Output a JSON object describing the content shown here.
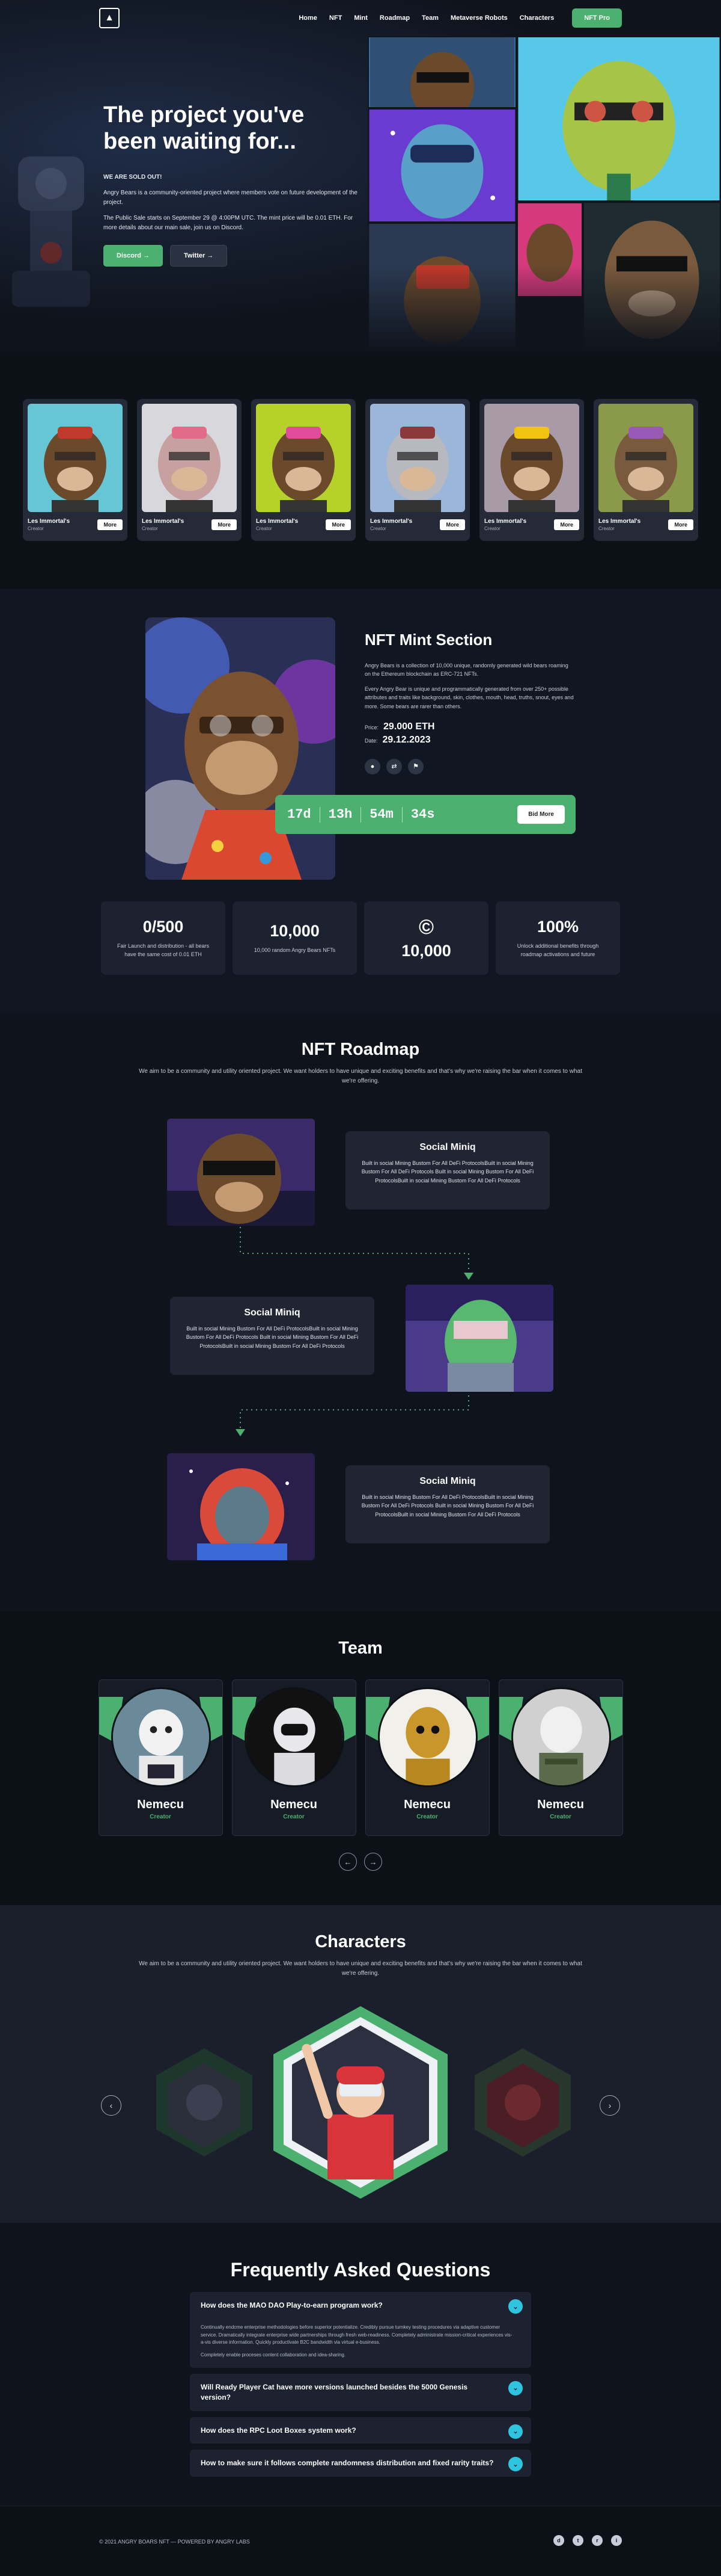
{
  "brand": {
    "logo_icon": "ape-logo-icon",
    "accent": "#4cb070",
    "faq_accent": "#2dc5e0"
  },
  "nav": {
    "links": [
      "Home",
      "NFT",
      "Mint",
      "Roadmap",
      "Team",
      "Metaverse Robots",
      "Characters"
    ],
    "cta": "NFT Pro"
  },
  "hero": {
    "title_line1": "The project you've",
    "title_line2": "been waiting for...",
    "sold_out": "WE ARE SOLD OUT!",
    "p1": "Angry Bears is a community-oriented project where members vote on future development of the project.",
    "p2": "The Public Sale starts on September 29 @ 4:00PM UTC. The mint price will be 0.01 ETH. For more details about our main sale, join us on Discord.",
    "discord_btn": "Discord →",
    "twitter_btn": "Twitter →"
  },
  "cards": [
    {
      "name": "Les Immortal's",
      "role": "Creator",
      "more": "More"
    },
    {
      "name": "Les Immortal's",
      "role": "Creator",
      "more": "More"
    },
    {
      "name": "Les Immortal's",
      "role": "Creator",
      "more": "More"
    },
    {
      "name": "Les Immortal's",
      "role": "Creator",
      "more": "More"
    },
    {
      "name": "Les Immortal's",
      "role": "Creator",
      "more": "More"
    },
    {
      "name": "Les Immortal's",
      "role": "Creator",
      "more": "More"
    }
  ],
  "mint": {
    "title": "NFT Mint Section",
    "p1": "Angry Bears is a collection of 10,000 unique, randomly generated wild bears roaming on the Ethereum blockchain as ERC-721 NFTs.",
    "p2": "Every Angry Bear is unique and programmatically generated from over 250+ possible attributes and traits like background, skin, clothes, mouth, head, truths, snout, eyes and more. Some bears are rarer than others.",
    "price_label": "Price:",
    "price": "29.000 ETH",
    "date_label": "Date:",
    "date": "29.12.2023",
    "timer": {
      "days": "17d",
      "hours": "13h",
      "mins": "54m",
      "secs": "34s"
    },
    "bid_btn": "Bid More",
    "stats": [
      {
        "big": "0/500",
        "small": "Fair Launch and distribution - all bears have the same cost of 0.01 ETH"
      },
      {
        "big": "10,000",
        "small": "10,000 random Angry Bears NFTs"
      },
      {
        "big": "©",
        "small": "10,000"
      },
      {
        "big": "100%",
        "small": "Unlock additional benefits through roadmap activations and future"
      }
    ]
  },
  "roadmap": {
    "title": "NFT Roadmap",
    "subtitle": "We aim to be a community and utility oriented project. We want holders to have unique and exciting benefits and that's why we're raising the bar when it comes to what we're offering.",
    "items": [
      {
        "title": "Social Miniq",
        "text": "Built in social Mining Bustom For All DeFi ProtocolsBuilt in social Mining Bustom For All DeFi Protocols Built in social Mining Bustom For All DeFi ProtocolsBuilt in social Mining Bustom For All DeFi Protocols"
      },
      {
        "title": "Social Miniq",
        "text": "Built in social Mining Bustom For All DeFi ProtocolsBuilt in social Mining Bustom For All DeFi Protocols Built in social Mining Bustom For All DeFi ProtocolsBuilt in social Mining Bustom For All DeFi Protocols"
      },
      {
        "title": "Social Miniq",
        "text": "Built in social Mining Bustom For All DeFi ProtocolsBuilt in social Mining Bustom For All DeFi Protocols Built in social Mining Bustom For All DeFi ProtocolsBuilt in social Mining Bustom For All DeFi Protocols"
      }
    ]
  },
  "team": {
    "title": "Team",
    "members": [
      {
        "name": "Nemecu",
        "role": "Creator"
      },
      {
        "name": "Nemecu",
        "role": "Creator"
      },
      {
        "name": "Nemecu",
        "role": "Creator"
      },
      {
        "name": "Nemecu",
        "role": "Creator"
      }
    ],
    "prev": "←",
    "next": "→"
  },
  "characters": {
    "title": "Characters",
    "subtitle": "We aim to be a community and utility oriented project. We want holders to have unique and exciting benefits and that's why we're raising the bar when it comes to what we're offering.",
    "prev": "‹",
    "next": "›"
  },
  "faq": {
    "title": "Frequently Asked Questions",
    "items": [
      {
        "q": "How does the MAO DAO Play-to-earn program work?",
        "open": true,
        "toggle": "⌄",
        "a1": "Continually endcme enterprise methodologies before superior potentialize. Credibly pursue turnkey testing procedures via adaptive customer service. Dramatically integrate enterprise wide partnerships through fresh web-readiness. Completely administrate mission-critical experiences vis-a-vis diverse information. Quickly productivate B2C bandwidth via virtual e-business.",
        "a2": "Completely enable proceses content collaboration and idea-sharing."
      },
      {
        "q": "Will Ready Player Cat have more versions launched besides the 5000 Genesis version?",
        "open": false,
        "toggle": "⌄"
      },
      {
        "q": "How does the RPC Loot Boxes system work?",
        "open": false,
        "toggle": "⌄"
      },
      {
        "q": "How to make sure it follows complete randomness distribution and fixed rarity traits?",
        "open": false,
        "toggle": "⌄"
      }
    ]
  },
  "footer": {
    "text": "© 2021 ANGRY BOARS NFT — POWERED BY ANGRY LABS",
    "socials": [
      "discord-icon",
      "twitter-icon",
      "reddit-icon",
      "instagram-icon"
    ]
  }
}
